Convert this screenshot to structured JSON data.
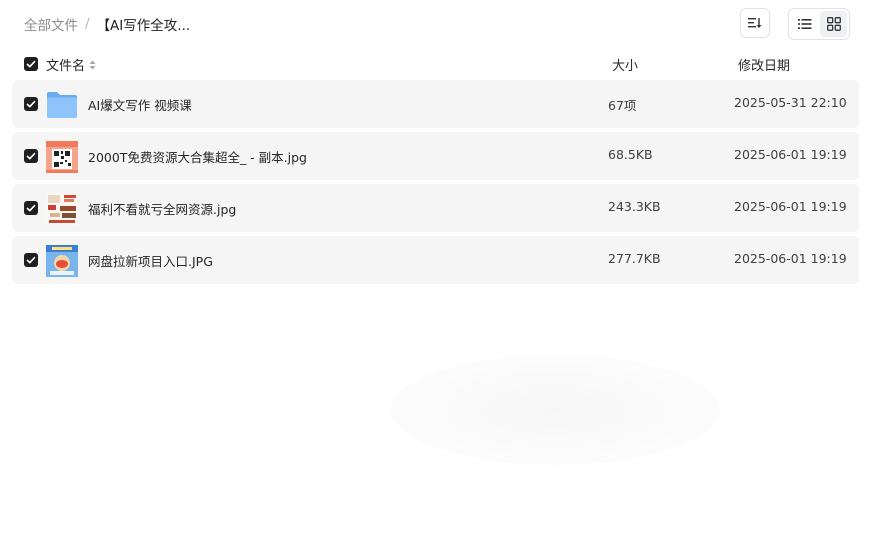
{
  "breadcrumb": {
    "root": "全部文件",
    "separator": "/",
    "current": "【AI写作全攻..."
  },
  "toolbar": {
    "sort_icon": "sort-icon",
    "list_view_icon": "list-view-icon",
    "grid_view_icon": "grid-view-icon",
    "active_view": "list"
  },
  "columns": {
    "name": "文件名",
    "size": "大小",
    "date": "修改日期"
  },
  "files": [
    {
      "name": "AI爆文写作 视频课",
      "size": "67项",
      "date": "2025-05-31 22:10",
      "type": "folder",
      "checked": true
    },
    {
      "name": "2000T免费资源大合集超全_ - 副本.jpg",
      "size": "68.5KB",
      "date": "2025-06-01 19:19",
      "type": "image",
      "checked": true
    },
    {
      "name": "福利不看就亏全网资源.jpg",
      "size": "243.3KB",
      "date": "2025-06-01 19:19",
      "type": "image",
      "checked": true
    },
    {
      "name": "网盘拉新项目入口.JPG",
      "size": "277.7KB",
      "date": "2025-06-01 19:19",
      "type": "image",
      "checked": true
    }
  ],
  "colors": {
    "row_bg": "#f5f5f5",
    "checkbox": "#1f1f1f",
    "folder": "#7cb6f5"
  }
}
